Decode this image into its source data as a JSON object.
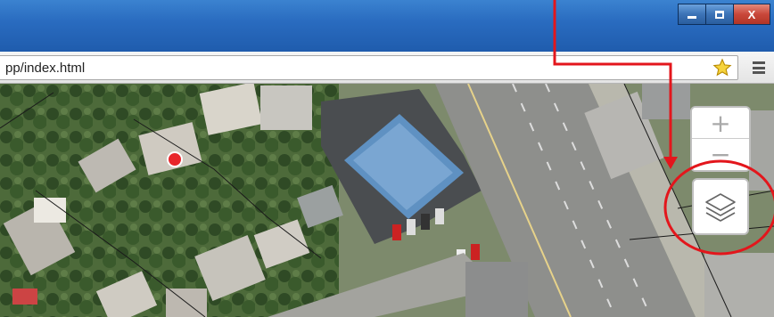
{
  "window": {
    "controls": {
      "minimize_icon": "minimize-icon",
      "maximize_icon": "maximize-icon",
      "close_label": "X"
    }
  },
  "browser": {
    "url": "pp/index.html",
    "bookmark_icon": "star-icon",
    "menu_icon": "hamburger-menu-icon"
  },
  "map": {
    "zoom_in_label": "+",
    "zoom_out_label": "−",
    "layers_icon": "layers-icon",
    "marker_color": "#e8262b"
  },
  "annotation": {
    "color": "#e3161c"
  },
  "colors": {
    "titlebar": "#2a6cc0",
    "close_button": "#c9473a"
  }
}
